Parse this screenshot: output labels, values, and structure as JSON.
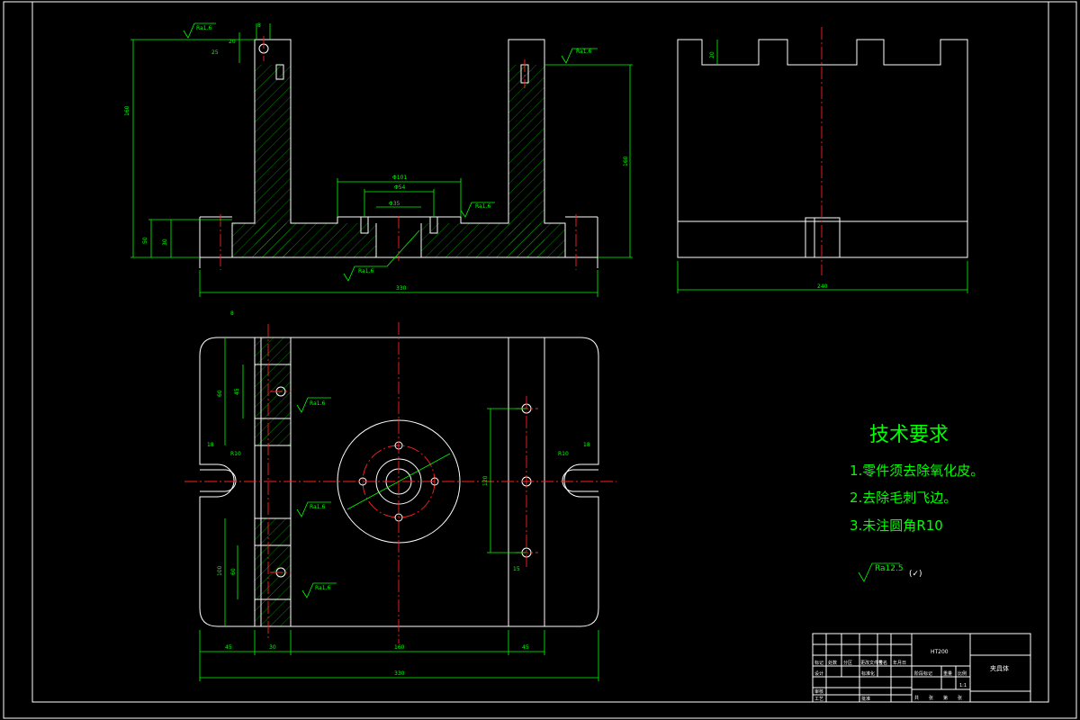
{
  "drawing": {
    "requirements": {
      "title": "技术要求",
      "items": [
        "1.零件须去除氧化皮。",
        "2.去除毛刺飞边。",
        "3.未注圆角R10"
      ]
    },
    "roughness_default": "Ra12.5",
    "roughness_default_suffix": "(✓)",
    "roughness_marks": [
      "Ra1.6",
      "Ra1.6",
      "Ra1.6",
      "Ra1.6",
      "Ra1.6",
      "Ra1.6",
      "Ra1.6",
      "Ra1.6"
    ],
    "front_view_dims": {
      "overall_width": "330",
      "overall_height": "160",
      "inner_height": "160",
      "base_height": "50",
      "base_small": "30",
      "center_outer": "Φ101",
      "center_inner": "Φ54",
      "center_bore": "Φ35",
      "top_small_a": "8",
      "top_small_b": "25",
      "top_small_c": "20"
    },
    "side_view_dims": {
      "overall_width": "240",
      "slot_depth": "20"
    },
    "plan_view_dims": {
      "left_seg": "45",
      "second_seg": "30",
      "middle_seg": "160",
      "right_seg": "45",
      "overall": "330",
      "left_edge": "18",
      "right_edge": "18",
      "radius_left": "R10",
      "radius_right": "R10",
      "vertical_spacing": "120",
      "small_offset": "15",
      "upper_block": "60",
      "upper_block_inner": "45",
      "lower_block": "100",
      "lower_block_inner": "60",
      "top_label": "8"
    },
    "title_block": {
      "name": "夹具体",
      "material": "HT200",
      "scale": "1:1",
      "cells": [
        "标记",
        "处数",
        "分区",
        "更改文件号",
        "签名",
        "年月日",
        "设计",
        "标准化",
        "阶段标记",
        "重量",
        "比例",
        "审核",
        "工艺",
        "批准",
        "共",
        "张",
        "第",
        "张"
      ]
    }
  }
}
